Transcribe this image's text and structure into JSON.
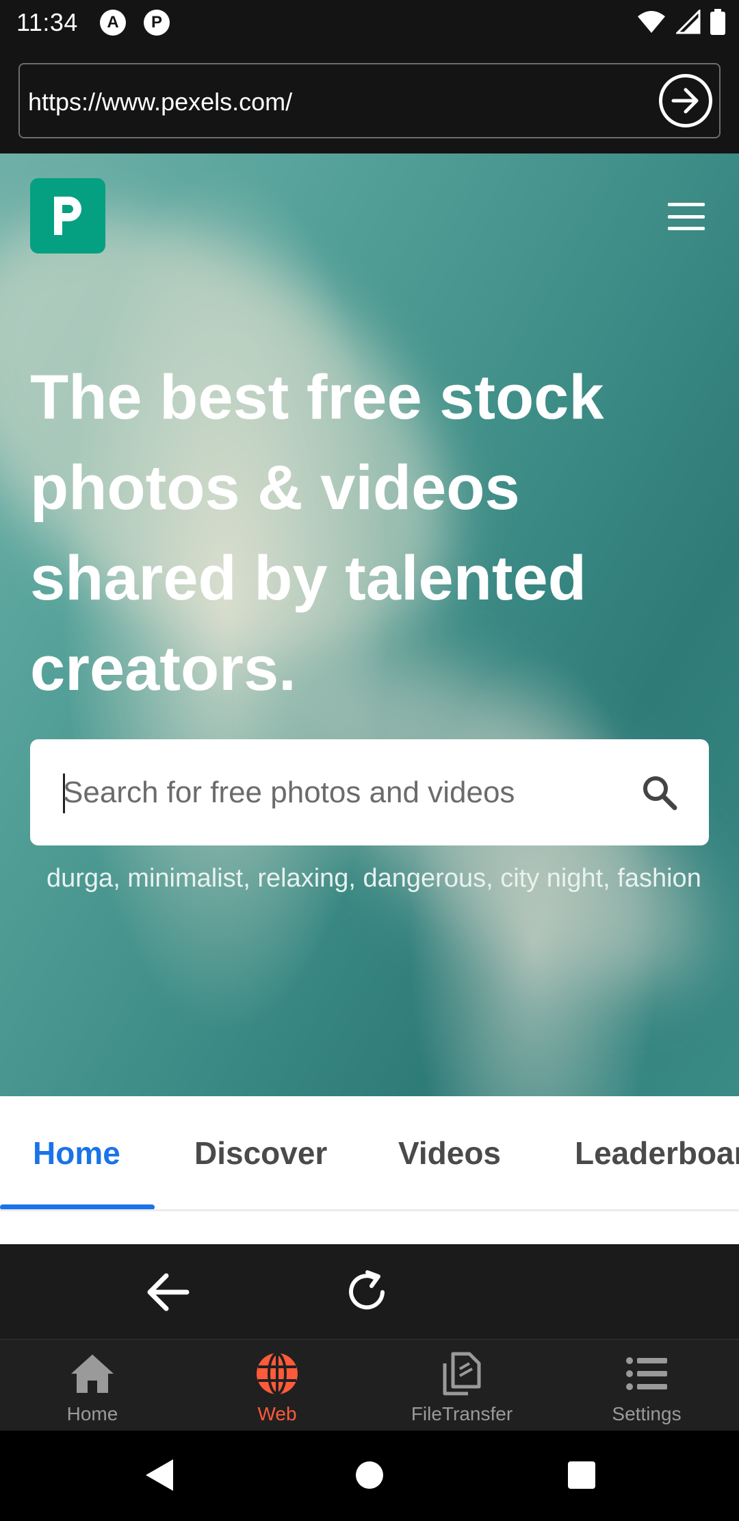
{
  "status_bar": {
    "time": "11:34",
    "app_icons": [
      "A",
      "P"
    ],
    "icons": [
      "wifi-icon",
      "signal-icon",
      "battery-icon"
    ]
  },
  "url_bar": {
    "url": "https://www.pexels.com/",
    "go_icon": "arrow-right-circle-icon"
  },
  "site": {
    "logo_letter": "P",
    "brand_color": "#05a081",
    "hero_title": "The best free stock photos & videos shared by talented creators.",
    "search": {
      "placeholder": "Search for free photos and videos",
      "value": ""
    },
    "suggestions": "durga, minimalist, relaxing, dangerous, city night, fashion m",
    "tabs": [
      {
        "label": "Home",
        "active": true
      },
      {
        "label": "Discover",
        "active": false
      },
      {
        "label": "Videos",
        "active": false
      },
      {
        "label": "Leaderboard",
        "active": false
      }
    ],
    "accent_color": "#1a73e8"
  },
  "browser_controls": {
    "back_icon": "arrow-left-icon",
    "reload_icon": "reload-icon"
  },
  "app_nav": {
    "items": [
      {
        "label": "Home",
        "icon": "home-icon",
        "active": false
      },
      {
        "label": "Web",
        "icon": "globe-icon",
        "active": true
      },
      {
        "label": "FileTransfer",
        "icon": "files-icon",
        "active": false
      },
      {
        "label": "Settings",
        "icon": "list-icon",
        "active": false
      }
    ],
    "active_color": "#ff5a3a"
  },
  "system_nav": {
    "icons": [
      "back-triangle-icon",
      "home-circle-icon",
      "recents-square-icon"
    ]
  }
}
